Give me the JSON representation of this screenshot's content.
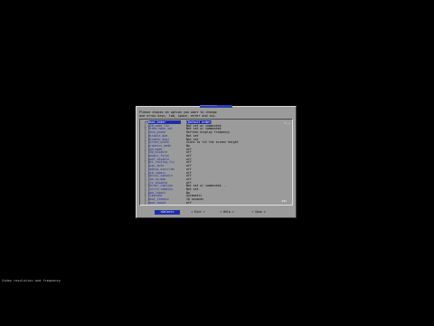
{
  "dialog": {
    "title": "────────────────",
    "prompt_line1": "Please choose an option you want to change",
    "prompt_line2": "and arrow keys, tab, space, enter and esc."
  },
  "options": [
    {
      "flag": "[X]",
      "name": "Boot_Order",
      "value": "[Default order]",
      "selected": true
    },
    {
      "flag": "[ ]",
      "name": "A20_mode_fix",
      "value": "Not set or commented"
    },
    {
      "flag": "[ ]",
      "name": "video_mode_set",
      "value": "Not set or commented"
    },
    {
      "flag": "[ ]",
      "name": "vesa_probe",
      "value": "Refresh display frequency"
    },
    {
      "flag": "[ ]",
      "name": "disable_apm",
      "value": "Not set"
    },
    {
      "flag": "[ ]",
      "name": "disable_acpi",
      "value": "Not set"
    },
    {
      "flag": "[ ]",
      "name": "screen_width",
      "value": "Scale to fit the screen height"
    },
    {
      "flag": "[ ]",
      "name": "graphics_mode",
      "value": "No"
    },
    {
      "flag": "[ ]",
      "name": "vga_mode",
      "value": "off"
    },
    {
      "flag": "[ ]",
      "name": "lba_disable",
      "value": "off"
    },
    {
      "flag": "[ ]",
      "name": "noapic_force",
      "value": "off"
    },
    {
      "flag": "[ ]",
      "name": "hpet_disable",
      "value": "off"
    },
    {
      "flag": "[ ]",
      "name": "pci_routing_fix",
      "value": "off"
    },
    {
      "flag": "[ ]",
      "name": "acpi_auto",
      "value": "off"
    },
    {
      "flag": "[ ]",
      "name": "smbios_override",
      "value": "off"
    },
    {
      "flag": "[ ]",
      "name": "usb_legacy",
      "value": "off"
    },
    {
      "flag": "[ ]",
      "name": "serial_console",
      "value": "off"
    },
    {
      "flag": "[ ]",
      "name": "ide_no_dma",
      "value": "off"
    },
    {
      "flag": "[ ]",
      "name": "rtc_disable",
      "value": "off"
    },
    {
      "flag": "[ ]",
      "name": "kernel_cmdline",
      "value": "Not set or commented  -"
    },
    {
      "flag": "[ ]",
      "name": "initrd_ramdisk",
      "value": "Not set"
    },
    {
      "flag": "[ ]",
      "name": "kbd_layout",
      "value": "No"
    },
    {
      "flag": "[ ]",
      "name": "timezone",
      "value": "Automatic"
    },
    {
      "flag": "[ ]",
      "name": "boot_timeout",
      "value": "10 seconds"
    },
    {
      "flag": "[ ]",
      "name": "boot_sound",
      "value": "off"
    }
  ],
  "scroll": {
    "up": "^(-)",
    "pos": "45%"
  },
  "buttons": [
    {
      "label": "<Select>",
      "active": true
    },
    {
      "label": "< Exit >"
    },
    {
      "label": "< Help >"
    },
    {
      "label": "< Save >"
    }
  ],
  "status_text": "Video resolution and frequency"
}
